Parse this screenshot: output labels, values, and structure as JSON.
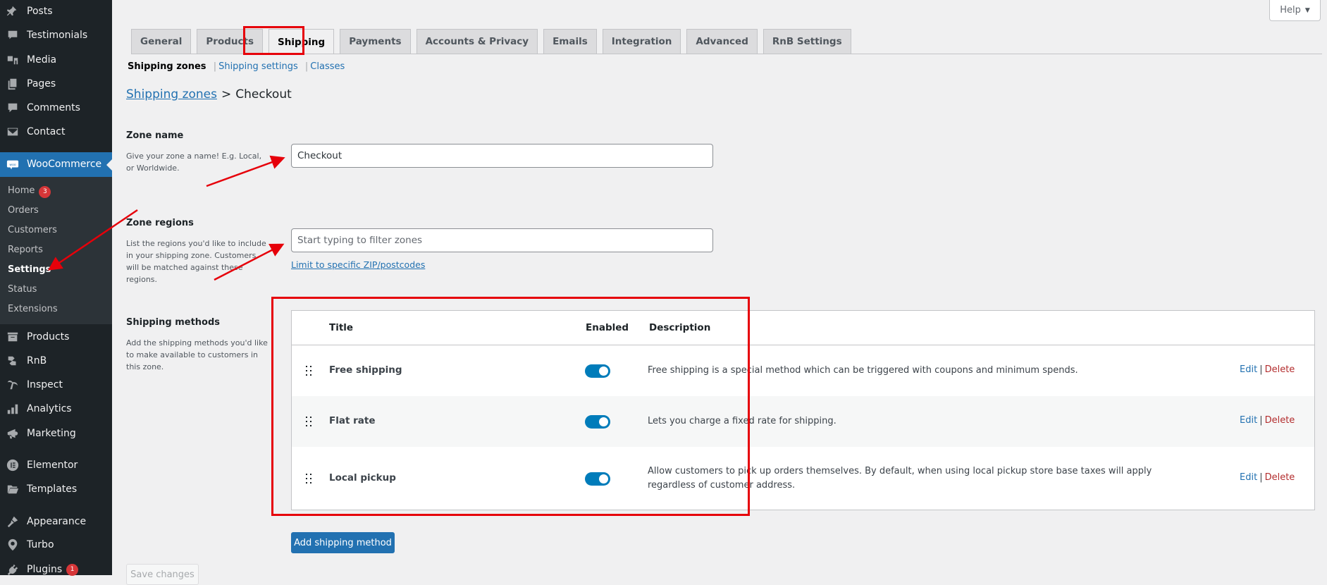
{
  "sidebar": {
    "top_items": [
      {
        "label": "Posts",
        "icon": "pin-icon"
      },
      {
        "label": "Testimonials",
        "icon": "testimonial-icon"
      },
      {
        "label": "Media",
        "icon": "media-icon"
      },
      {
        "label": "Pages",
        "icon": "pages-icon"
      },
      {
        "label": "Comments",
        "icon": "comment-icon"
      },
      {
        "label": "Contact",
        "icon": "envelope-icon"
      }
    ],
    "woocommerce": {
      "label": "WooCommerce",
      "icon": "woo-icon"
    },
    "woo_sub_items": [
      {
        "label": "Home",
        "badge": "3"
      },
      {
        "label": "Orders"
      },
      {
        "label": "Customers"
      },
      {
        "label": "Reports"
      },
      {
        "label": "Settings",
        "current": true
      },
      {
        "label": "Status"
      },
      {
        "label": "Extensions"
      }
    ],
    "bottom_items": [
      {
        "label": "Products",
        "icon": "archive-icon"
      },
      {
        "label": "RnB",
        "icon": "rnb-icon"
      },
      {
        "label": "Inspect",
        "icon": "palm-icon"
      },
      {
        "label": "Analytics",
        "icon": "bar-chart-icon"
      },
      {
        "label": "Marketing",
        "icon": "megaphone-icon"
      },
      {
        "label": "Elementor",
        "icon": "elementor-icon"
      },
      {
        "label": "Templates",
        "icon": "folder-icon"
      },
      {
        "label": "Appearance",
        "icon": "brush-icon"
      },
      {
        "label": "Turbo",
        "icon": "map-pin-icon"
      },
      {
        "label": "Plugins",
        "icon": "plug-icon",
        "badge": "1"
      }
    ]
  },
  "help": {
    "label": "Help",
    "caret": "▼"
  },
  "tabs": [
    {
      "label": "General"
    },
    {
      "label": "Products"
    },
    {
      "label": "Shipping",
      "active": true
    },
    {
      "label": "Payments"
    },
    {
      "label": "Accounts & Privacy"
    },
    {
      "label": "Emails"
    },
    {
      "label": "Integration"
    },
    {
      "label": "Advanced"
    },
    {
      "label": "RnB Settings"
    }
  ],
  "subnav": {
    "current": "Shipping zones",
    "links": [
      "Shipping settings",
      "Classes"
    ],
    "separator": "|"
  },
  "breadcrumb": {
    "link": "Shipping zones",
    "separator": ">",
    "current": "Checkout"
  },
  "zone_name": {
    "label": "Zone name",
    "description": "Give your zone a name! E.g. Local, or Worldwide.",
    "value": "Checkout"
  },
  "zone_regions": {
    "label": "Zone regions",
    "description": "List the regions you'd like to include in your shipping zone. Customers will be matched against these regions.",
    "placeholder": "Start typing to filter zones",
    "limit_link": "Limit to specific ZIP/postcodes"
  },
  "shipping_methods": {
    "label": "Shipping methods",
    "description": "Add the shipping methods you'd like to make available to customers in this zone.",
    "columns": {
      "title": "Title",
      "enabled": "Enabled",
      "description": "Description"
    },
    "rows": [
      {
        "title": "Free shipping",
        "enabled": true,
        "description": "Free shipping is a special method which can be triggered with coupons and minimum spends.",
        "edit": "Edit",
        "delete": "Delete"
      },
      {
        "title": "Flat rate",
        "enabled": true,
        "description": "Lets you charge a fixed rate for shipping.",
        "edit": "Edit",
        "delete": "Delete"
      },
      {
        "title": "Local pickup",
        "enabled": true,
        "description": "Allow customers to pick up orders themselves. By default, when using local pickup store base taxes will apply regardless of customer address.",
        "edit": "Edit",
        "delete": "Delete"
      }
    ],
    "action_separator": "|"
  },
  "buttons": {
    "add_method": "Add shipping method",
    "save": "Save changes"
  },
  "colors": {
    "accent": "#2271b1",
    "toggle_on": "#007cba",
    "delete": "#b32d2e",
    "annotation": "#e6000a",
    "sidebar_bg": "#1d2327"
  }
}
